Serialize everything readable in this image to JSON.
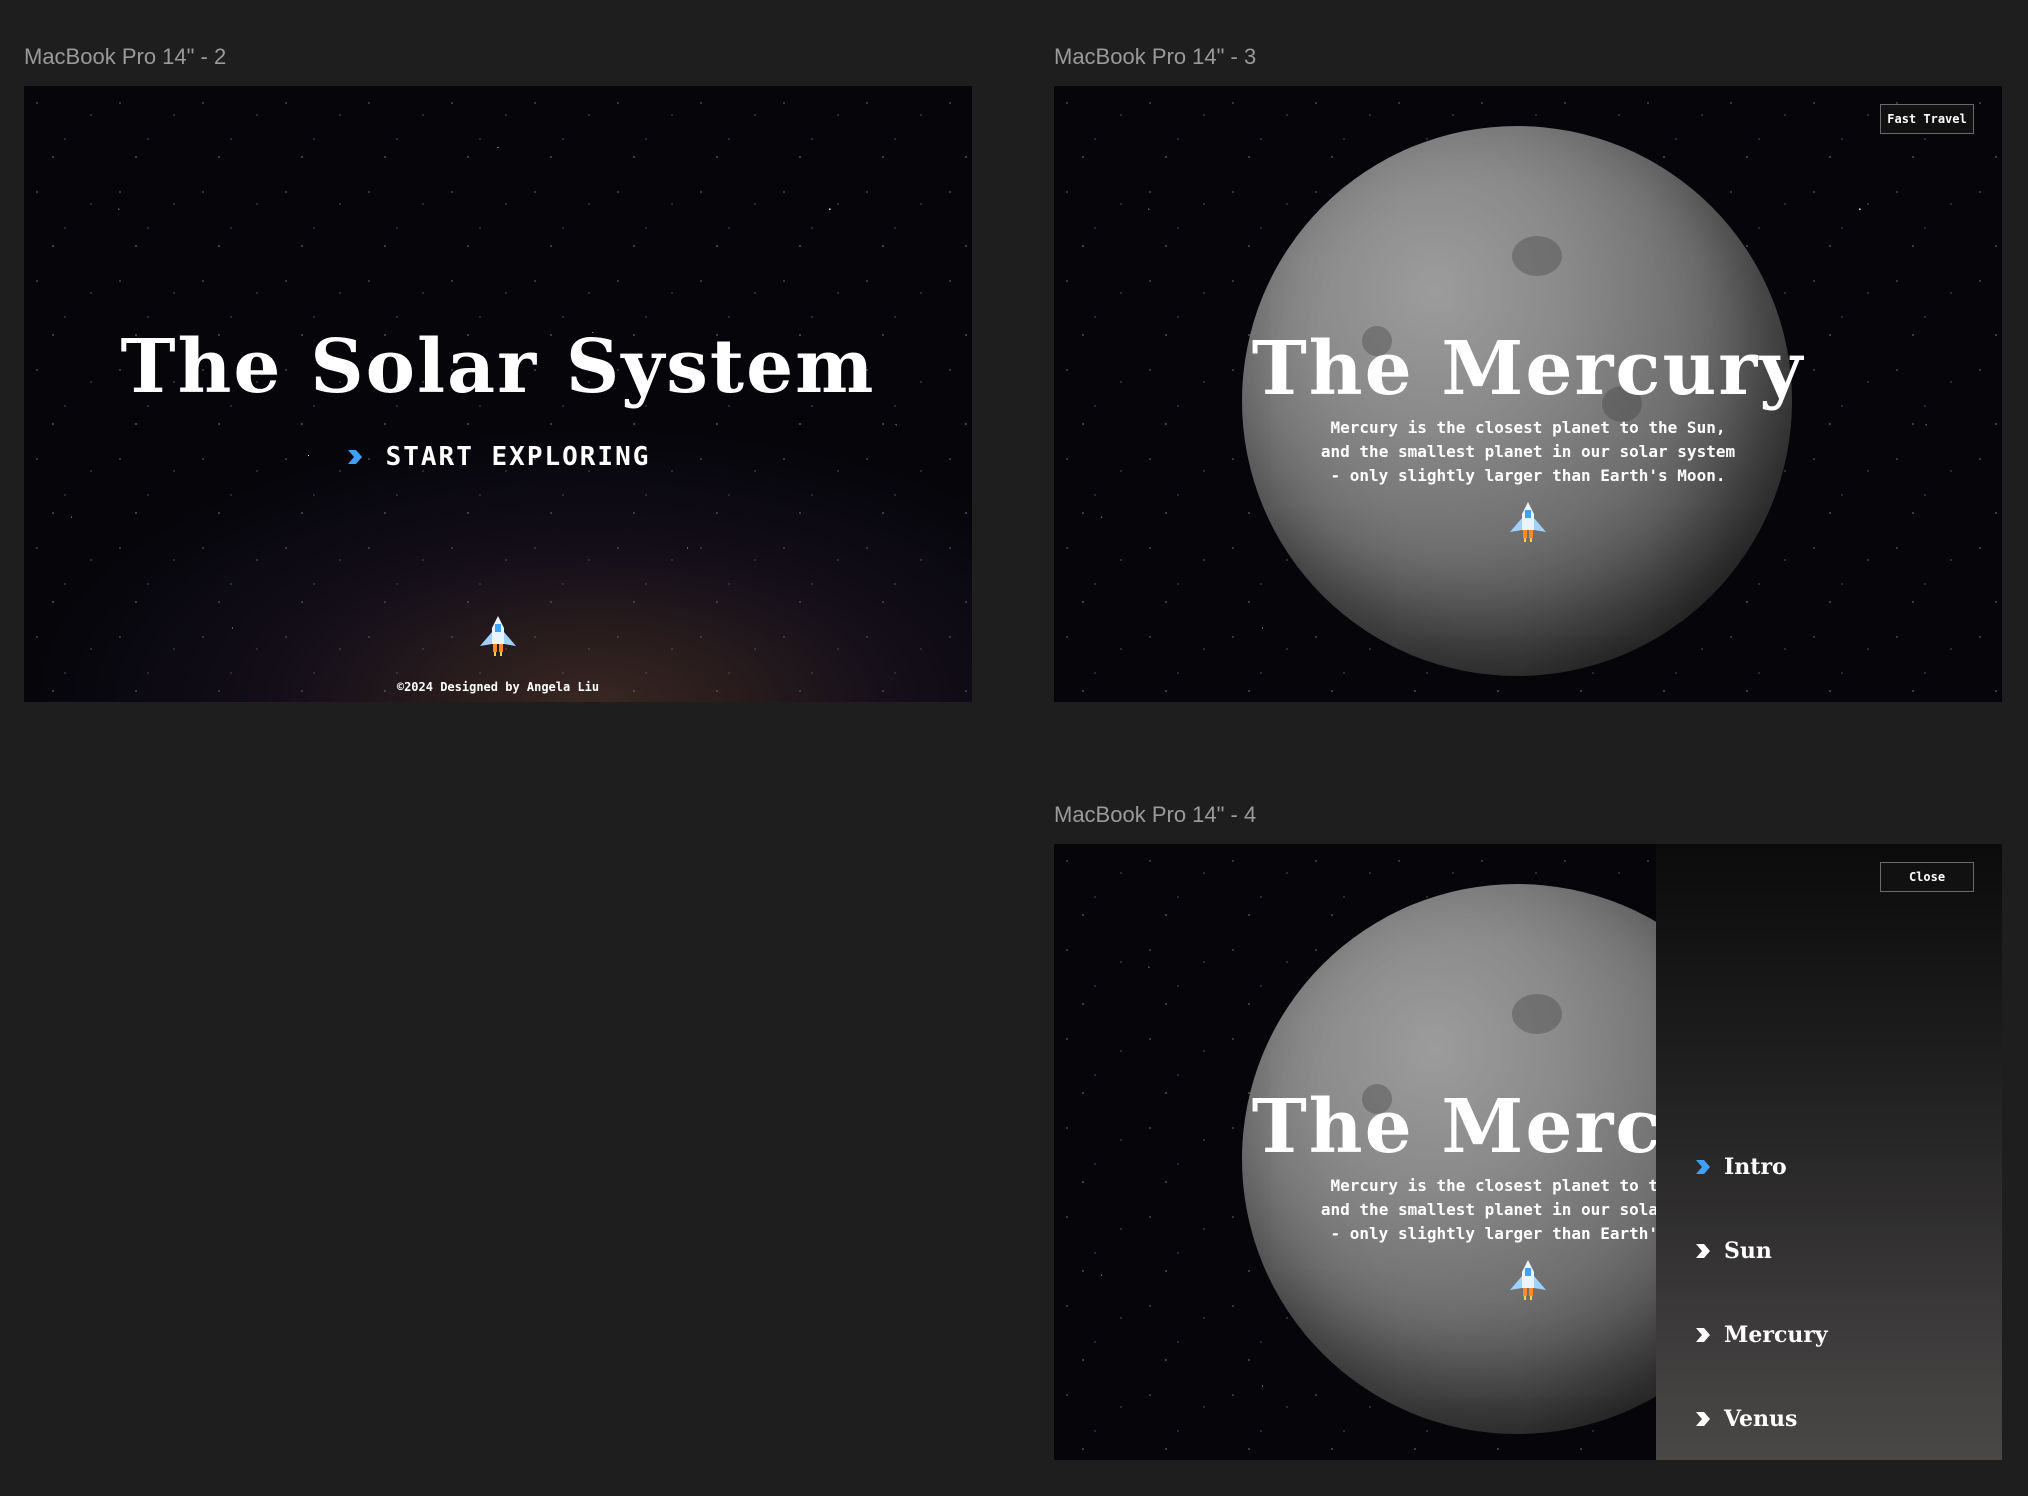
{
  "frames": {
    "frame2": {
      "label": "MacBook Pro 14\" - 2"
    },
    "frame3": {
      "label": "MacBook Pro 14\" - 3"
    },
    "frame4": {
      "label": "MacBook Pro 14\" - 4"
    }
  },
  "intro": {
    "title": "The Solar System",
    "cta": "START EXPLORING",
    "footer": "©2024 Designed by Angela Liu"
  },
  "mercury": {
    "title": "The Mercury",
    "description_line1": "Mercury is the closest planet to the Sun,",
    "description_line2": "and the smallest planet in our solar system",
    "description_line3": "- only slightly larger than Earth's Moon.",
    "fast_travel": "Fast Travel"
  },
  "menu": {
    "close": "Close",
    "items": [
      {
        "label": "Intro",
        "active": true
      },
      {
        "label": "Sun",
        "active": false
      },
      {
        "label": "Mercury",
        "active": false
      },
      {
        "label": "Venus",
        "active": false
      }
    ]
  },
  "colors": {
    "canvas_bg": "#1e1e1e",
    "accent_blue": "#3ea0ff",
    "text": "#ffffff"
  },
  "icons": [
    "chevron-right-icon",
    "spaceship-icon"
  ]
}
